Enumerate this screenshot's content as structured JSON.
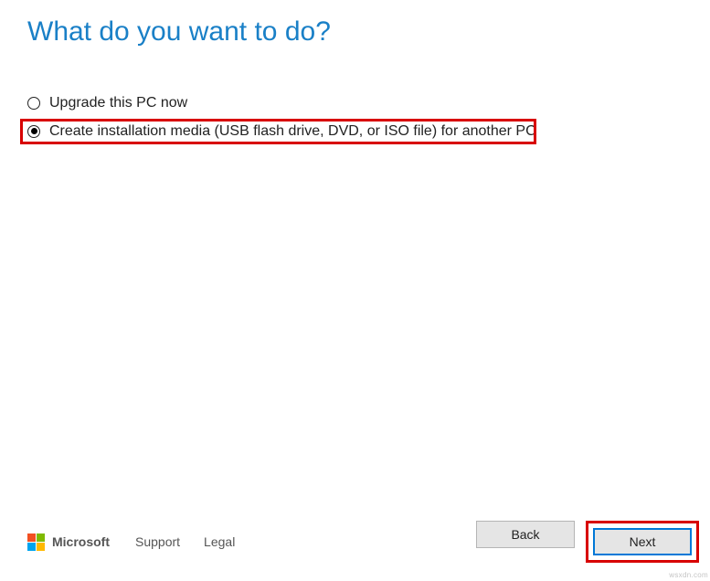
{
  "heading": "What do you want to do?",
  "options": {
    "upgrade": {
      "label": "Upgrade this PC now",
      "selected": false
    },
    "create_media": {
      "label": "Create installation media (USB flash drive, DVD, or ISO file) for another PC",
      "selected": true
    }
  },
  "footer": {
    "brand": "Microsoft",
    "links": {
      "support": "Support",
      "legal": "Legal"
    },
    "buttons": {
      "back": "Back",
      "next": "Next"
    }
  },
  "watermark": "wsxdn.com",
  "colors": {
    "accent": "#1a80c7",
    "highlight": "#d80000",
    "button_primary_border": "#0078d7"
  }
}
